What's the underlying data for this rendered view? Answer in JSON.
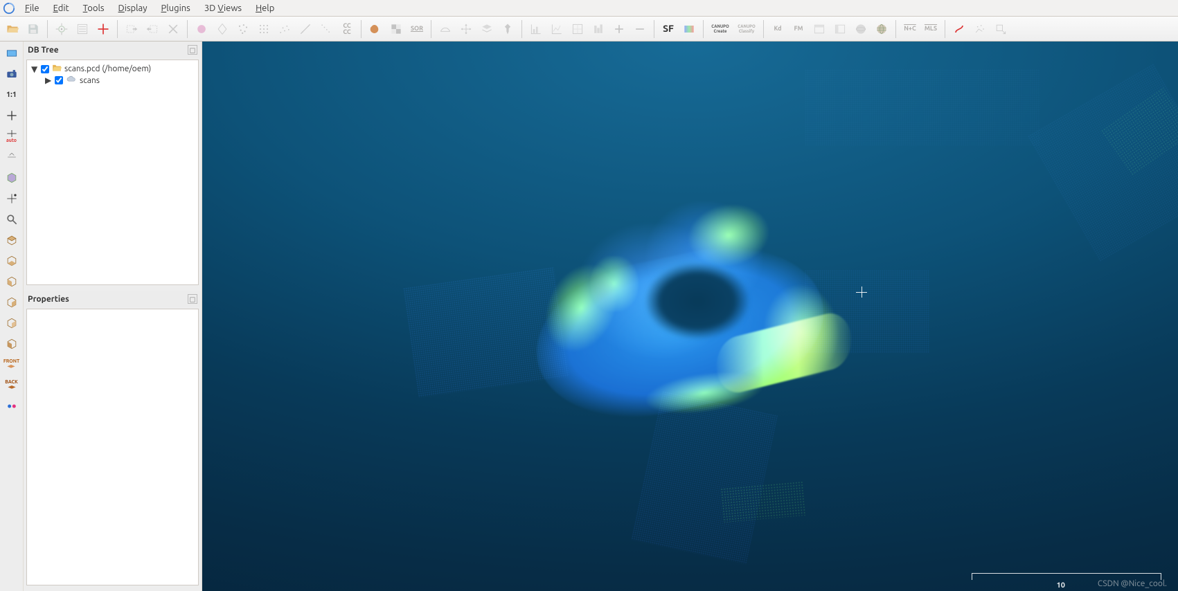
{
  "menubar": {
    "items": [
      {
        "label": "File",
        "mnemonic": "F"
      },
      {
        "label": "Edit",
        "mnemonic": "E"
      },
      {
        "label": "Tools",
        "mnemonic": "T"
      },
      {
        "label": "Display",
        "mnemonic": "D"
      },
      {
        "label": "Plugins",
        "mnemonic": "P"
      },
      {
        "label": "3D Views",
        "mnemonic": "V"
      },
      {
        "label": "Help",
        "mnemonic": "H"
      }
    ]
  },
  "toolbar": {
    "groups": [
      [
        "open",
        "save"
      ],
      [
        "point-pick",
        "list",
        "target-cross"
      ],
      [
        "align-in",
        "align-out",
        "delete"
      ],
      [
        "sphere",
        "diamond",
        "dots",
        "grid-dots",
        "scatter",
        "diag-up",
        "diag-down",
        "cc-align"
      ],
      [
        "primitive",
        "checker",
        "sor"
      ],
      [
        "measure",
        "move",
        "layers",
        "pin"
      ],
      [
        "chart-l",
        "chart-axes",
        "chart-grid",
        "chart-stack",
        "plus",
        "minus"
      ],
      [
        "sf-text",
        "sf-grad",
        "canupo-create",
        "canupo-classify"
      ],
      [
        "kd",
        "fm",
        "panel1",
        "panel2",
        "globe-gray",
        "globe-stripes"
      ],
      [
        "nplusc",
        "mls"
      ],
      [
        "s-curve",
        "scan-tool",
        "export-tool"
      ]
    ],
    "labels": {
      "cc-align": "CC\nCC",
      "sor": "SOR",
      "sf-text": "SF",
      "canupo-create": "CANUPO\nCreate",
      "canupo-classify": "CANUPO\nClassify",
      "kd": "Kd",
      "fm": "FM",
      "nplusc": "N+C",
      "mls": "MLS"
    }
  },
  "vtoolbar": {
    "buttons": [
      "rect-blue",
      "camera",
      "one-to-one",
      "plus-cursor",
      "plus-auto",
      "ortho-arrows",
      "cube-fill",
      "plus-move",
      "zoom",
      "cube-top",
      "cube-bottom",
      "cube-left",
      "cube-right",
      "cube-front",
      "cube-back",
      "front-label",
      "back-label",
      "flickr"
    ],
    "labels": {
      "one-to-one": "1:1",
      "plus-auto": "auto",
      "front-label": "FRONT",
      "back-label": "BACK"
    }
  },
  "db_tree": {
    "title": "DB Tree",
    "items": [
      {
        "expanded": true,
        "checked": true,
        "icon": "folder",
        "label": "scans.pcd (/home/oem)",
        "indent": 0
      },
      {
        "expanded": false,
        "hasChildren": true,
        "checked": true,
        "icon": "cloud",
        "label": "scans",
        "indent": 1
      }
    ]
  },
  "properties": {
    "title": "Properties"
  },
  "viewport": {
    "scale_value": "10",
    "watermark": "CSDN @Nice_cool."
  }
}
